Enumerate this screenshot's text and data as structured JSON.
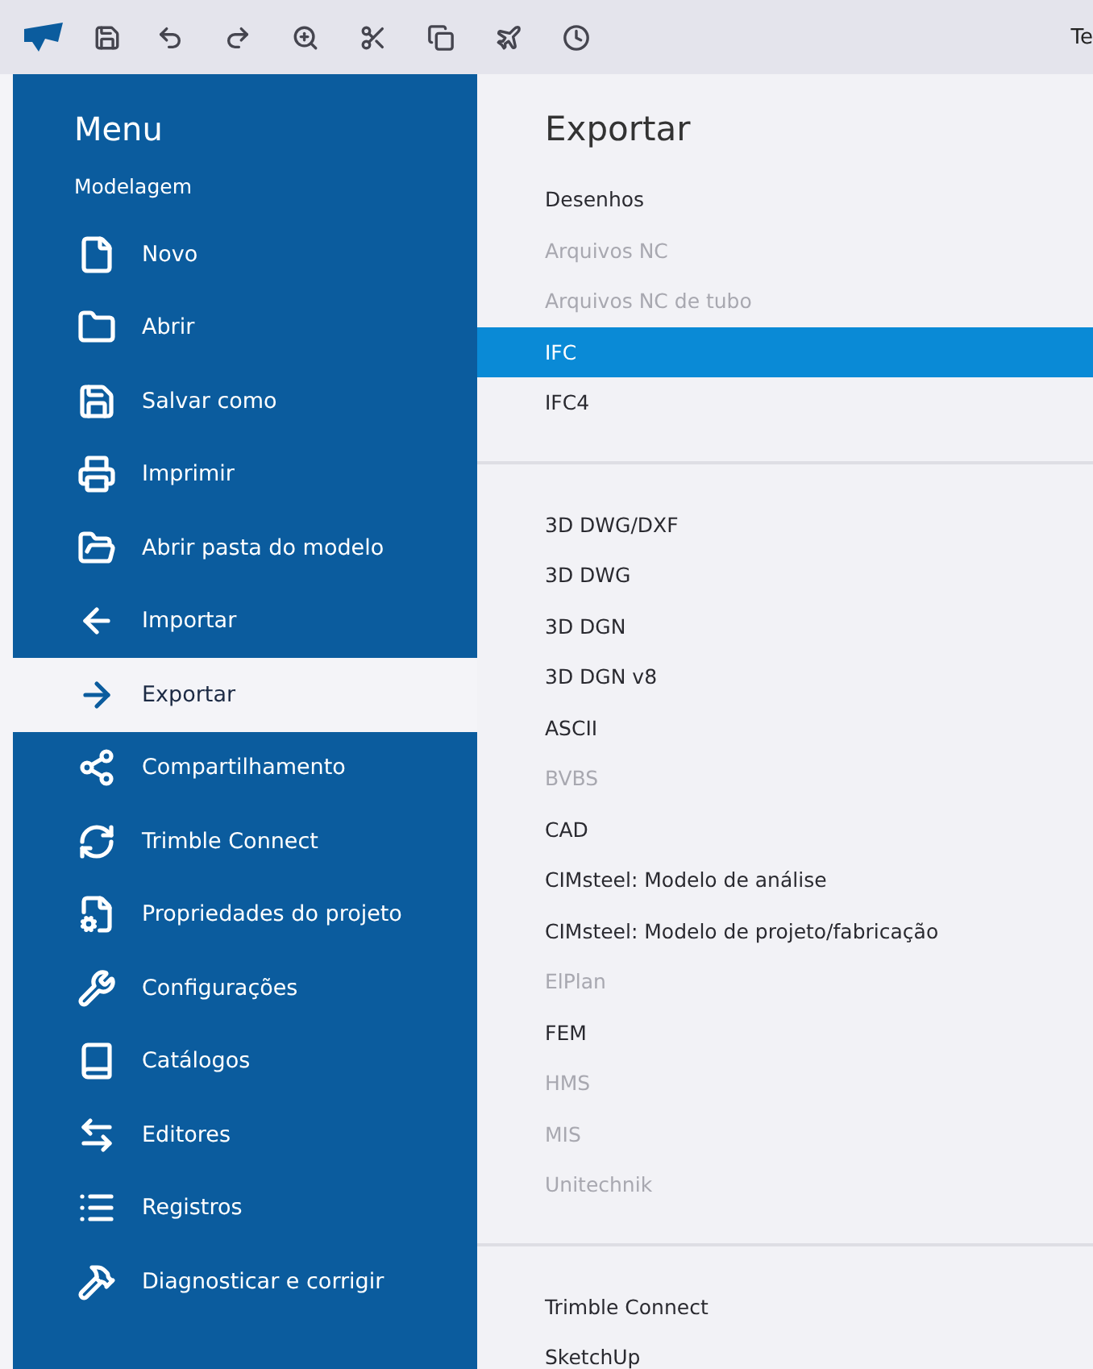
{
  "toolbar": {
    "trailing_text": "Te"
  },
  "menu": {
    "title": "Menu",
    "section": "Modelagem",
    "items": [
      {
        "label": "Novo",
        "selected": false
      },
      {
        "label": "Abrir",
        "selected": false
      },
      {
        "label": "Salvar como",
        "selected": false
      },
      {
        "label": "Imprimir",
        "selected": false
      },
      {
        "label": "Abrir pasta do modelo",
        "selected": false
      },
      {
        "label": "Importar",
        "selected": false
      },
      {
        "label": "Exportar",
        "selected": true
      },
      {
        "label": "Compartilhamento",
        "selected": false
      },
      {
        "label": "Trimble Connect",
        "selected": false
      },
      {
        "label": "Propriedades do projeto",
        "selected": false
      },
      {
        "label": "Configurações",
        "selected": false
      },
      {
        "label": "Catálogos",
        "selected": false
      },
      {
        "label": "Editores",
        "selected": false
      },
      {
        "label": "Registros",
        "selected": false
      },
      {
        "label": "Diagnosticar e corrigir",
        "selected": false
      }
    ]
  },
  "panel": {
    "title": "Exportar",
    "groups": [
      {
        "items": [
          {
            "label": "Desenhos",
            "disabled": false,
            "selected": false
          },
          {
            "label": "Arquivos NC",
            "disabled": true,
            "selected": false
          },
          {
            "label": "Arquivos NC de tubo",
            "disabled": true,
            "selected": false
          },
          {
            "label": "IFC",
            "disabled": false,
            "selected": true
          },
          {
            "label": "IFC4",
            "disabled": false,
            "selected": false
          }
        ]
      },
      {
        "items": [
          {
            "label": "3D DWG/DXF",
            "disabled": false,
            "selected": false
          },
          {
            "label": "3D DWG",
            "disabled": false,
            "selected": false
          },
          {
            "label": "3D DGN",
            "disabled": false,
            "selected": false
          },
          {
            "label": "3D DGN v8",
            "disabled": false,
            "selected": false
          },
          {
            "label": "ASCII",
            "disabled": false,
            "selected": false
          },
          {
            "label": "BVBS",
            "disabled": true,
            "selected": false
          },
          {
            "label": "CAD",
            "disabled": false,
            "selected": false
          },
          {
            "label": "CIMsteel: Modelo de análise",
            "disabled": false,
            "selected": false
          },
          {
            "label": "CIMsteel: Modelo de projeto/fabricação",
            "disabled": false,
            "selected": false
          },
          {
            "label": "ElPlan",
            "disabled": true,
            "selected": false
          },
          {
            "label": "FEM",
            "disabled": false,
            "selected": false
          },
          {
            "label": "HMS",
            "disabled": true,
            "selected": false
          },
          {
            "label": "MIS",
            "disabled": true,
            "selected": false
          },
          {
            "label": "Unitechnik",
            "disabled": true,
            "selected": false
          }
        ]
      },
      {
        "items": [
          {
            "label": "Trimble Connect",
            "disabled": false,
            "selected": false
          },
          {
            "label": "SketchUp",
            "disabled": false,
            "selected": false
          }
        ]
      }
    ]
  }
}
